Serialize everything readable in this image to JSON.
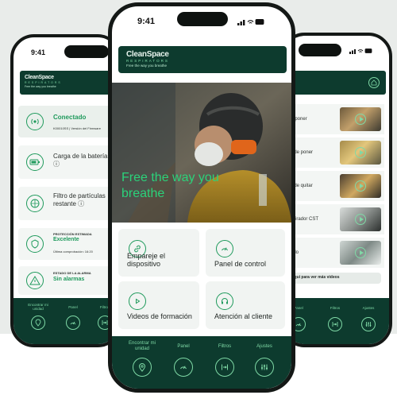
{
  "brand": {
    "name": "CleanSpace",
    "subline": "RESPIRATORS",
    "tagline": "Free the way you breathe"
  },
  "left_phone": {
    "time": "9:41",
    "connection": {
      "status": "Conectado",
      "detail": "K00010SS | Versión del Firmware"
    },
    "battery": {
      "label": "Carga de la batería ⓘ"
    },
    "filter": {
      "label": "Filtro de partículas restante ⓘ"
    },
    "protection": {
      "title": "PROTECCIÓN ESTIMADA",
      "value": "Excelente",
      "last_check": "Última comprobación: 16:20"
    },
    "alarm": {
      "title": "ESTADO DE LA ALARMA",
      "value": "Sin alarmas"
    },
    "nav": [
      {
        "label": "Encontrar mi unidad",
        "icon": "location-icon"
      },
      {
        "label": "Panel",
        "icon": "gauge-icon"
      },
      {
        "label": "Filtros",
        "icon": "filter-icon"
      }
    ]
  },
  "center_phone": {
    "time": "9:41",
    "hero_text": "Free the way you breathe",
    "tiles": [
      {
        "label": "Empareje el dispositivo",
        "icon": "link-icon"
      },
      {
        "label": "Panel de control",
        "icon": "gauge-icon"
      },
      {
        "label": "Videos de formación",
        "icon": "play-icon"
      },
      {
        "label": "Atención al cliente",
        "icon": "headset-icon"
      }
    ],
    "nav": [
      {
        "label": "Encontrar mi unidad",
        "icon": "location-icon"
      },
      {
        "label": "Panel",
        "icon": "gauge-icon"
      },
      {
        "label": "Filtros",
        "icon": "filter-icon"
      },
      {
        "label": "Ajustes",
        "icon": "settings-icon"
      }
    ]
  },
  "right_phone": {
    "videos": [
      {
        "title": "o de poner"
      },
      {
        "title": "fácil de poner"
      },
      {
        "title": "fácil de quitar"
      },
      {
        "title": "Respirador CST"
      },
      {
        "title": "estado"
      }
    ],
    "more_link": "clic aquí para ver más videos",
    "nav": [
      {
        "label": "Panel",
        "icon": "gauge-icon"
      },
      {
        "label": "Filtros",
        "icon": "filter-icon"
      },
      {
        "label": "Ajustes",
        "icon": "settings-icon"
      }
    ]
  },
  "colors": {
    "brand_dark": "#0d3b2e",
    "accent_green": "#1f9a5c",
    "bright_green": "#2bd27a",
    "mint": "#7fd9a6"
  }
}
